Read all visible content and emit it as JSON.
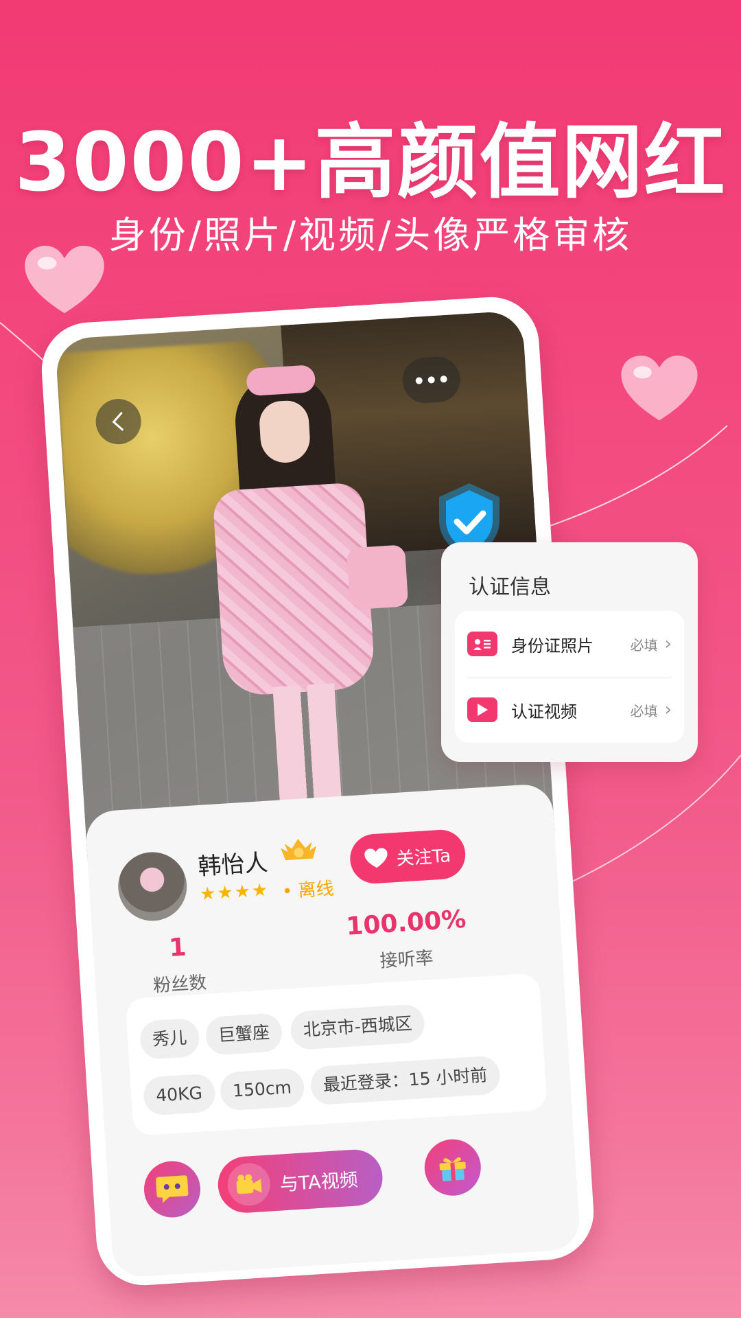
{
  "hero": {
    "headline": "3000+高颜值网红",
    "subline": "身份/照片/视频/头像严格审核"
  },
  "profile": {
    "name": "韩怡人",
    "stars": "★★★★",
    "status": "• 离线",
    "follow_label": "关注Ta",
    "fans_count": "1",
    "fans_label": "粉丝数",
    "answer_rate": "100.00%",
    "answer_rate_label": "接听率",
    "tags": [
      "秀儿",
      "巨蟹座",
      "北京市-西城区",
      "40KG",
      "150cm",
      "最近登录：15 小时前"
    ]
  },
  "actions": {
    "video_label": "与TA视频"
  },
  "verification": {
    "title": "认证信息",
    "rows": [
      {
        "label": "身份证照片",
        "required": "必填"
      },
      {
        "label": "认证视频",
        "required": "必填"
      }
    ]
  },
  "colors": {
    "brand_pink": "#f3376f",
    "accent_yellow": "#f7b500",
    "shield_blue": "#1aa6f2"
  }
}
